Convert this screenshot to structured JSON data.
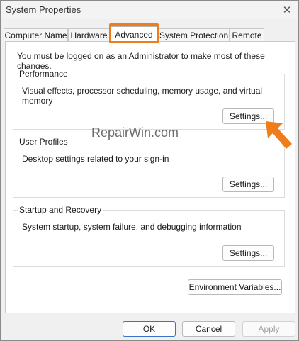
{
  "window": {
    "title": "System Properties",
    "close_glyph": "✕"
  },
  "tabs": [
    {
      "label": "Computer Name",
      "active": false
    },
    {
      "label": "Hardware",
      "active": false
    },
    {
      "label": "Advanced",
      "active": true
    },
    {
      "label": "System Protection",
      "active": false
    },
    {
      "label": "Remote",
      "active": false
    }
  ],
  "highlight_color": "#f07d1b",
  "content": {
    "intro": "You must be logged on as an Administrator to make most of these changes.",
    "performance": {
      "label": "Performance",
      "description": "Visual effects, processor scheduling, memory usage, and virtual memory",
      "button": "Settings..."
    },
    "user_profiles": {
      "label": "User Profiles",
      "description": "Desktop settings related to your sign-in",
      "button": "Settings..."
    },
    "startup_recovery": {
      "label": "Startup and Recovery",
      "description": "System startup, system failure, and debugging information",
      "button": "Settings..."
    },
    "environment_button": "Environment Variables..."
  },
  "watermark": "RepairWin.com",
  "footer": {
    "ok": "OK",
    "cancel": "Cancel",
    "apply": "Apply"
  }
}
